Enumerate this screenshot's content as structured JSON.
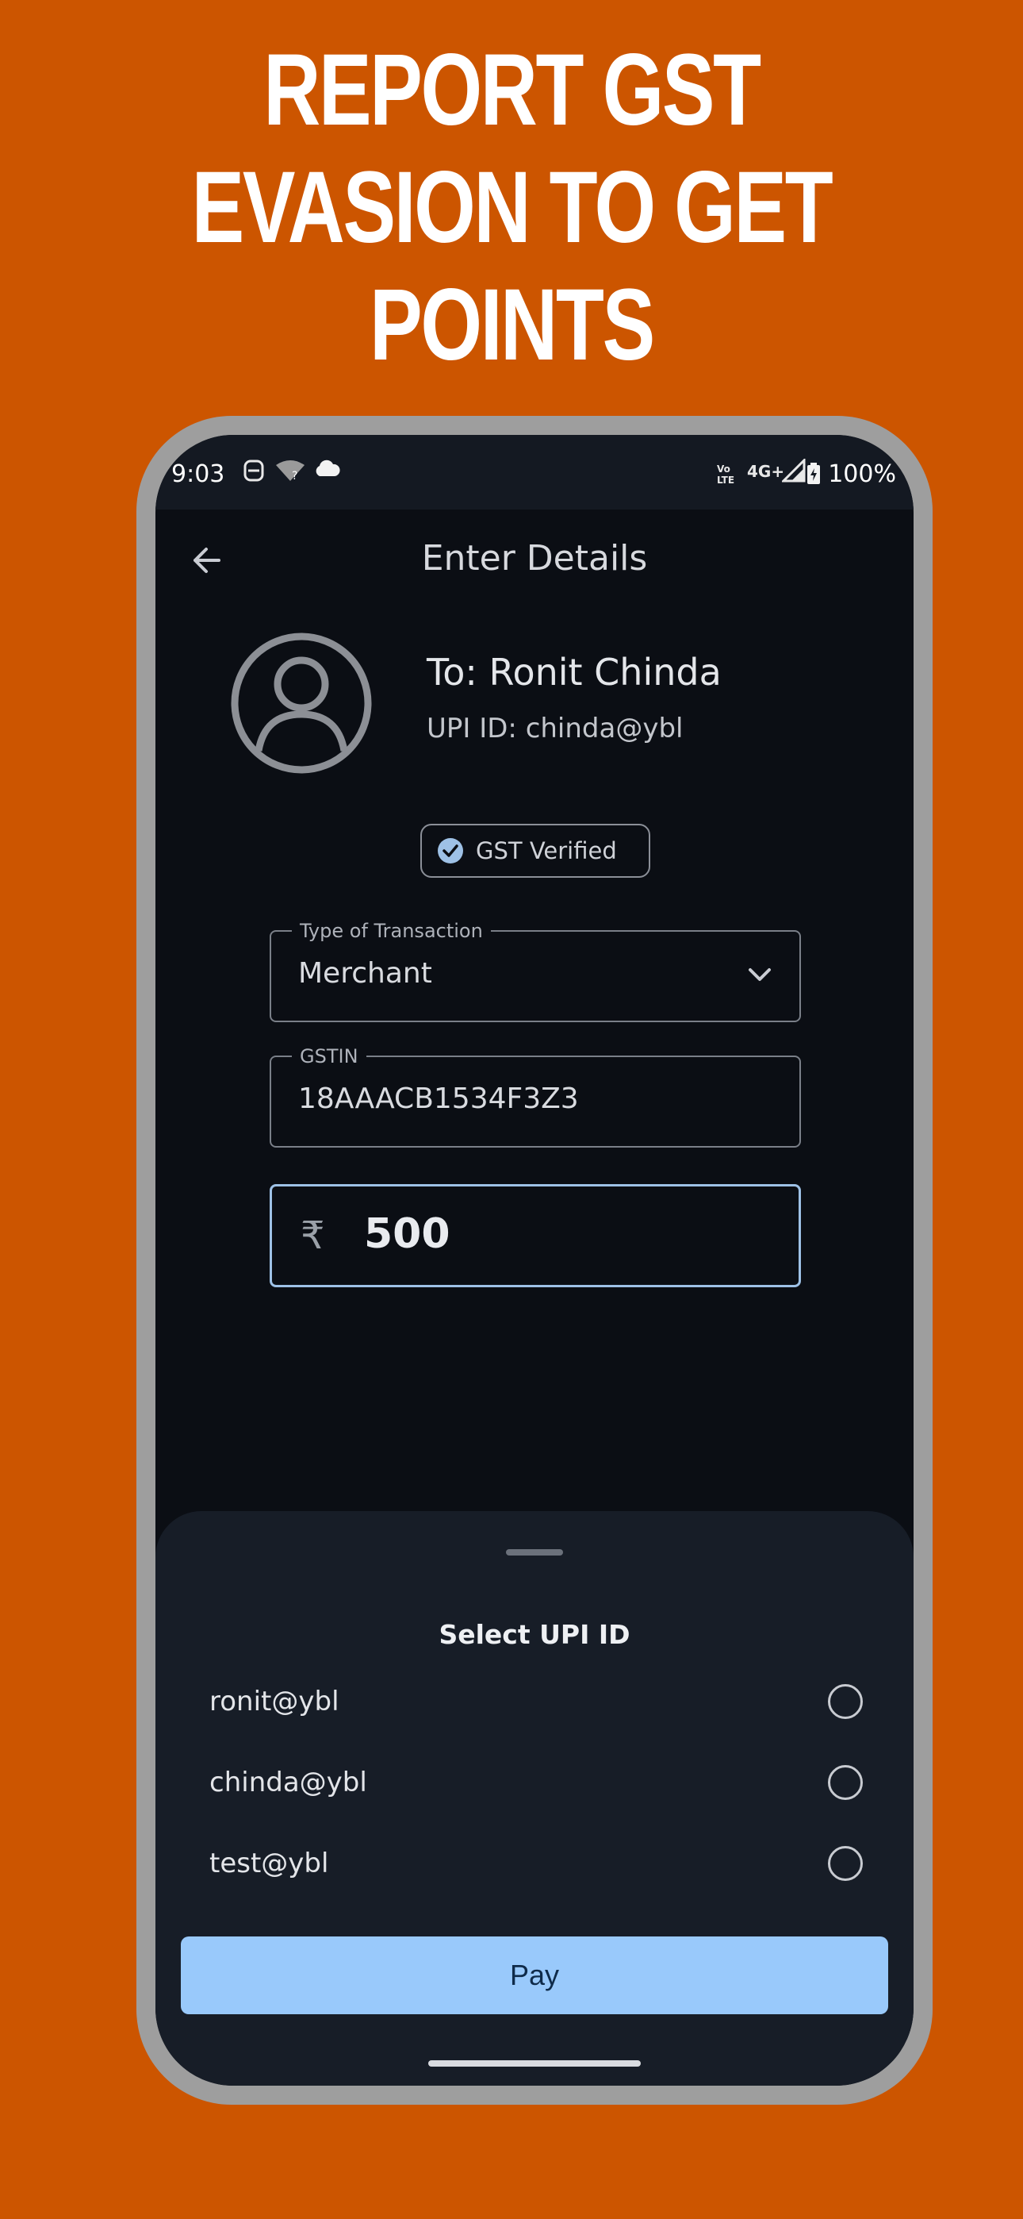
{
  "promo": {
    "headline_lines": [
      "REPORT GST",
      "EVASION TO GET",
      "POINTS"
    ]
  },
  "statusbar": {
    "time": "9:03",
    "network": "4G+",
    "battery": "100%"
  },
  "appbar": {
    "title": "Enter Details",
    "back_icon": "arrow-left-icon"
  },
  "recipient": {
    "to": "To: Ronit Chinda",
    "upi": "UPI ID: chinda@ybl"
  },
  "gst_badge": {
    "label": "GST Verified",
    "icon": "check-circle-icon"
  },
  "form": {
    "transaction_type": {
      "label": "Type of Transaction",
      "value": "Merchant"
    },
    "gstin": {
      "label": "GSTIN",
      "value": "18AAACB1534F3Z3"
    },
    "amount": {
      "currency_symbol": "₹",
      "value": "500"
    }
  },
  "sheet": {
    "title": "Select UPI ID",
    "options": [
      {
        "label": "ronit@ybl",
        "selected": false
      },
      {
        "label": "chinda@ybl",
        "selected": false
      },
      {
        "label": "test@ybl",
        "selected": false
      }
    ],
    "pay_label": "Pay"
  },
  "colors": {
    "background": "#CC5500",
    "frame": "#9e9e9e",
    "screen": "#0b0e14",
    "sheet": "#171d27",
    "accent": "#99c9fb"
  }
}
